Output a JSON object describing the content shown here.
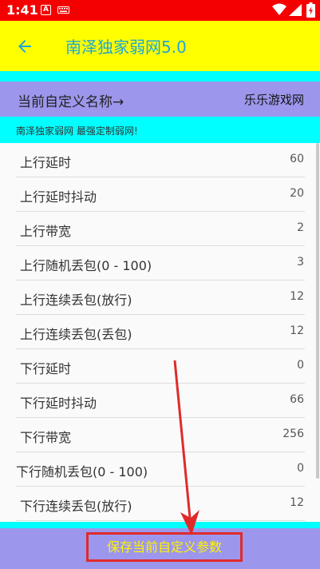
{
  "status_bar": {
    "time": "1:41",
    "notification_letter": "A"
  },
  "toolbar": {
    "title": "南泽独家弱网5.0"
  },
  "custom_name": {
    "label": "当前自定义名称→",
    "value": "乐乐游戏网"
  },
  "slogan": "南泽独家弱网  最强定制弱网!",
  "settings": [
    {
      "label": "上行延时",
      "value": "60"
    },
    {
      "label": "上行延时抖动",
      "value": "20"
    },
    {
      "label": "上行带宽",
      "value": "2"
    },
    {
      "label": "上行随机丢包(0 - 100)",
      "value": "3"
    },
    {
      "label": "上行连续丢包(放行)",
      "value": "12"
    },
    {
      "label": "上行连续丢包(丢包)",
      "value": "12"
    },
    {
      "label": "下行延时",
      "value": "0"
    },
    {
      "label": "下行延时抖动",
      "value": "66"
    },
    {
      "label": "下行带宽",
      "value": "256"
    },
    {
      "label": "下行随机丢包(0 - 100)",
      "value": "0"
    },
    {
      "label": "下行连续丢包(放行)",
      "value": "12"
    }
  ],
  "save_button": {
    "label": "保存当前自定义参数"
  },
  "colors": {
    "status_bar": "#f50000",
    "toolbar": "#ffff00",
    "accent_cyan": "#00ffff",
    "purple": "#9c97ec",
    "title": "#1ea7d6",
    "save_text": "#fff200",
    "annotation": "#e02a2a"
  }
}
